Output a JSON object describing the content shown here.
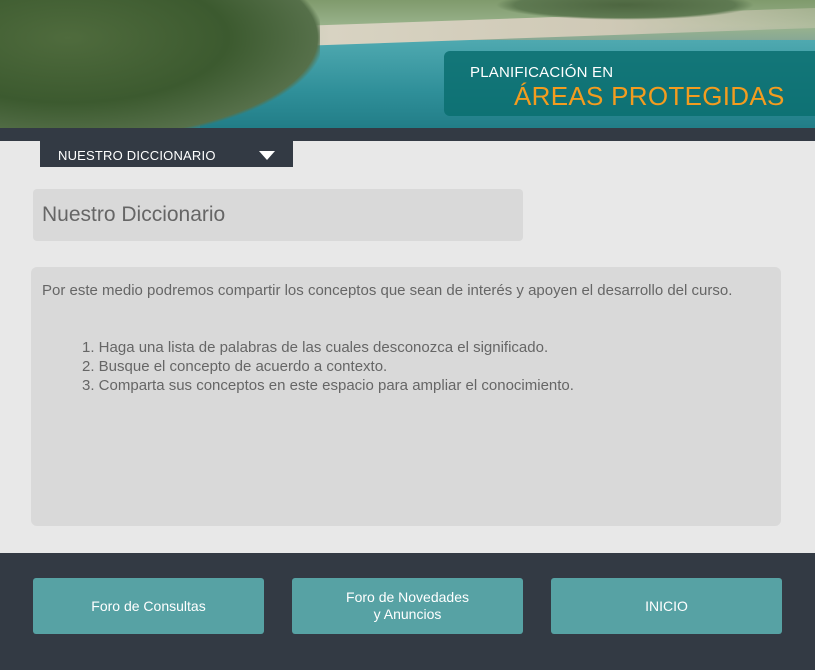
{
  "header": {
    "title_line1": "PLANIFICACIÓN EN",
    "title_line2": "ÁREAS PROTEGIDAS",
    "title_line1_color": "#ffffff",
    "title_line2_color": "#f39c1f"
  },
  "nav": {
    "dropdown_label": "NUESTRO DICCIONARIO",
    "dropdown_icon": "caret-down-icon"
  },
  "main": {
    "heading": "Nuestro Diccionario",
    "intro": "Por este medio podremos compartir los conceptos que sean de interés y apoyen el desarrollo del curso.",
    "steps": [
      "1. Haga una lista de palabras de las cuales desconozca el significado.",
      "2. Busque el concepto de acuerdo a contexto.",
      "3. Comparta sus conceptos en este espacio para ampliar el conocimiento."
    ]
  },
  "footer": {
    "buttons": [
      {
        "label": "Foro de Consultas"
      },
      {
        "label_line1": "Foro de Novedades",
        "label_line2": "y Anuncios"
      },
      {
        "label": "INICIO"
      }
    ],
    "button_color": "#57a2a4",
    "background_color": "#333a44"
  }
}
